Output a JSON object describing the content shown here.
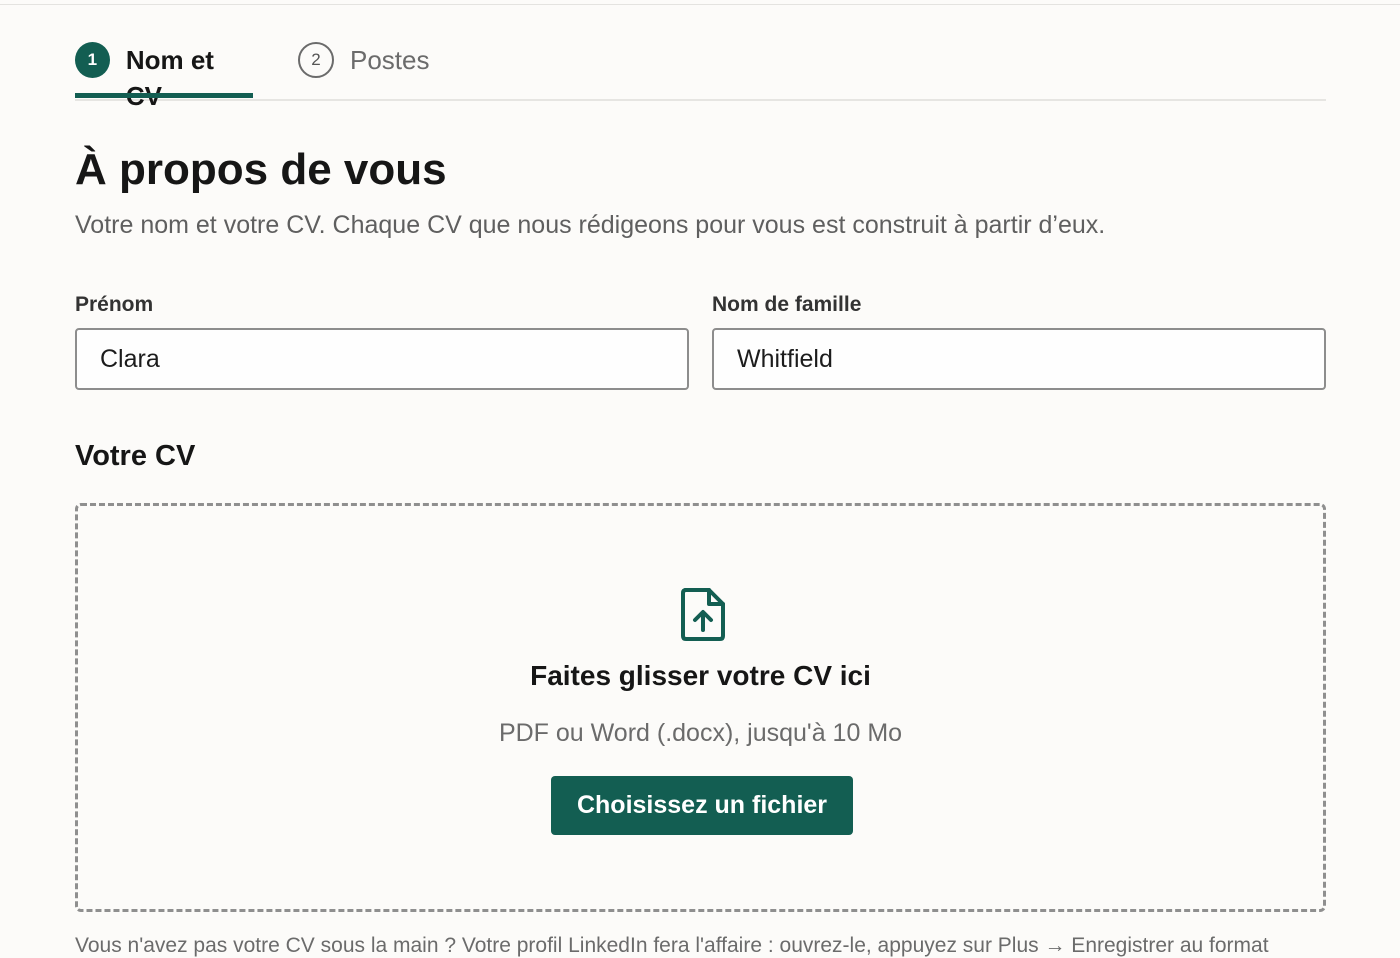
{
  "stepper": {
    "steps": [
      {
        "number": "1",
        "label": "Nom et CV",
        "state": "active"
      },
      {
        "number": "2",
        "label": "Postes",
        "state": "inactive"
      }
    ]
  },
  "header": {
    "title": "À propos de vous",
    "subtitle": "Votre nom et votre CV. Chaque CV que nous rédigeons pour vous est construit à partir d’eux."
  },
  "form": {
    "first_name": {
      "label": "Prénom",
      "value": "Clara"
    },
    "last_name": {
      "label": "Nom de famille",
      "value": "Whitfield"
    }
  },
  "cv": {
    "section_title": "Votre CV",
    "dropzone": {
      "icon": "file-upload-icon",
      "title": "Faites glisser votre CV ici",
      "hint": "PDF ou Word (.docx), jusqu'à 10 Mo",
      "button_label": "Choisissez un fichier"
    },
    "footnote": "Vous n'avez pas votre CV sous la main ? Votre profil LinkedIn fera l'affaire : ouvrez-le, appuyez sur Plus → Enregistrer au format"
  },
  "colors": {
    "accent": "#135e52",
    "background": "#fcfbf9",
    "muted_text": "#6b6b6b"
  }
}
